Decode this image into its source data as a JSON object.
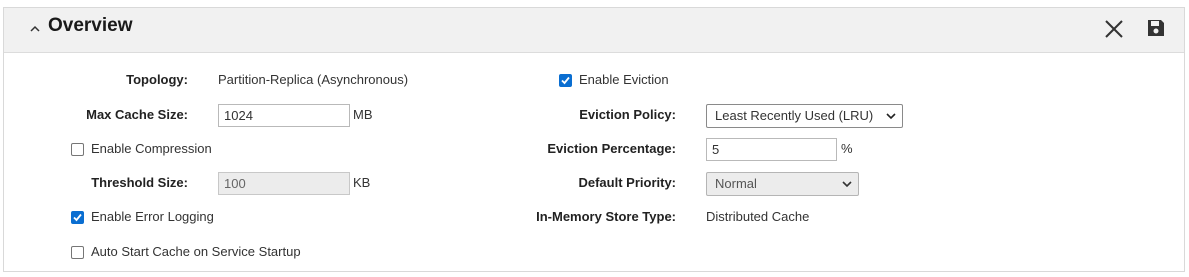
{
  "header": {
    "title": "Overview",
    "collapse_icon": "chevron-up-icon",
    "close_icon": "close-icon",
    "save_icon": "floppy-disk-icon"
  },
  "left": {
    "topology": {
      "label": "Topology:",
      "value": "Partition-Replica (Asynchronous)"
    },
    "max_cache_size": {
      "label": "Max Cache Size:",
      "value": "1024",
      "unit": "MB"
    },
    "enable_compression": {
      "label": "Enable Compression",
      "checked": false
    },
    "threshold_size": {
      "label": "Threshold Size:",
      "value": "100",
      "unit": "KB",
      "disabled": true
    },
    "enable_error_logging": {
      "label": "Enable Error Logging",
      "checked": true
    },
    "auto_start": {
      "label": "Auto Start Cache on Service Startup",
      "checked": false
    }
  },
  "right": {
    "enable_eviction": {
      "label": "Enable Eviction",
      "checked": true
    },
    "eviction_policy": {
      "label": "Eviction Policy:",
      "selected": "Least Recently Used (LRU)"
    },
    "eviction_percentage": {
      "label": "Eviction Percentage:",
      "value": "5",
      "unit": "%"
    },
    "default_priority": {
      "label": "Default Priority:",
      "selected": "Normal",
      "disabled": true
    },
    "in_memory_store_type": {
      "label": "In-Memory Store Type:",
      "value": "Distributed Cache"
    }
  },
  "colors": {
    "accent": "#0a6ed1",
    "header_bg": "#f1f1f1",
    "border": "#d9d9d9"
  }
}
